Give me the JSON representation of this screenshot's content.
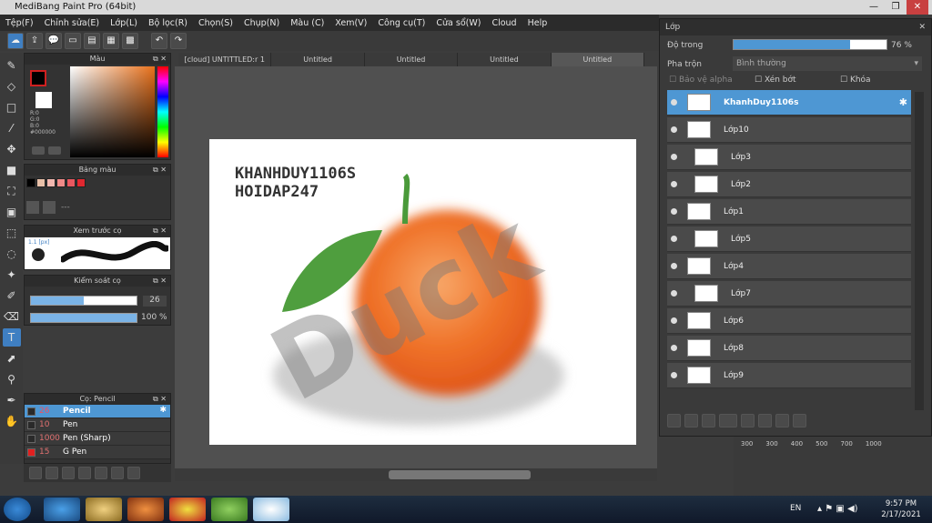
{
  "window": {
    "title": "MediBang Paint Pro (64bit)"
  },
  "menu": [
    "Tệp(F)",
    "Chỉnh sửa(E)",
    "Lớp(L)",
    "Bộ lọc(R)",
    "Chọn(S)",
    "Chụp(N)",
    "Màu (C)",
    "Xem(V)",
    "Công cụ(T)",
    "Cửa sổ(W)",
    "Cloud",
    "Help"
  ],
  "doc_tabs": [
    "[cloud] UNTITTLED:r 1",
    "Untitled",
    "Untitled",
    "Untitled",
    "Untitled"
  ],
  "color_panel": {
    "title": "Màu",
    "r": "R:0",
    "g": "G:0",
    "b": "B:0",
    "hex": "#000000"
  },
  "palette_panel": {
    "title": "Bảng màu",
    "swatches": [
      "#000000",
      "#e8c0a8",
      "#f2b8b0",
      "#f08a88",
      "#e85860",
      "#e02830"
    ],
    "dash": "---"
  },
  "preview_panel": {
    "title": "Xem trước cọ",
    "size_label": "1.1 [px]"
  },
  "brush_control": {
    "title": "Kiểm soát cọ",
    "size": "26",
    "opacity": "100 %",
    "size_fraction": 0.5,
    "opacity_fraction": 1.0
  },
  "brush_list": {
    "title": "Cọ: Pencil",
    "items": [
      {
        "size": "26",
        "name": "Pencil",
        "color": "#2a2a2a",
        "selected": true
      },
      {
        "size": "10",
        "name": "Pen",
        "color": "#2a2a2a",
        "selected": false
      },
      {
        "size": "1000",
        "name": "Pen (Sharp)",
        "color": "#2a2a2a",
        "selected": false
      },
      {
        "size": "15",
        "name": "G Pen",
        "color": "#e02020",
        "selected": false
      }
    ]
  },
  "canvas_text": {
    "line1": "KHANHDUY1106S",
    "line2": "HOIDAP247",
    "watermark": "Duck"
  },
  "layers_panel": {
    "title": "Lớp",
    "opacity_label": "Độ trong",
    "opacity_value": "76 %",
    "opacity_fraction": 0.76,
    "blend_label": "Pha trộn",
    "blend_value": "Bình thường",
    "protect_alpha": "Bảo vệ alpha",
    "clip": "Xén bớt",
    "lock": "Khóa",
    "layers": [
      {
        "name": "KhanhDuy1106s",
        "selected": true,
        "indent": false
      },
      {
        "name": "Lớp10",
        "selected": false,
        "indent": false
      },
      {
        "name": "Lớp3",
        "selected": false,
        "indent": true
      },
      {
        "name": "Lớp2",
        "selected": false,
        "indent": true
      },
      {
        "name": "Lớp1",
        "selected": false,
        "indent": false
      },
      {
        "name": "Lớp5",
        "selected": false,
        "indent": true
      },
      {
        "name": "Lớp4",
        "selected": false,
        "indent": false
      },
      {
        "name": "Lớp7",
        "selected": false,
        "indent": true
      },
      {
        "name": "Lớp6",
        "selected": false,
        "indent": false
      },
      {
        "name": "Lớp8",
        "selected": false,
        "indent": false
      },
      {
        "name": "Lớp9",
        "selected": false,
        "indent": false
      }
    ]
  },
  "ruler_ticks": [
    "300",
    "300",
    "400",
    "500",
    "700",
    "1000"
  ],
  "taskbar": {
    "lang": "EN",
    "time": "9:57 PM",
    "date": "2/17/2021"
  }
}
